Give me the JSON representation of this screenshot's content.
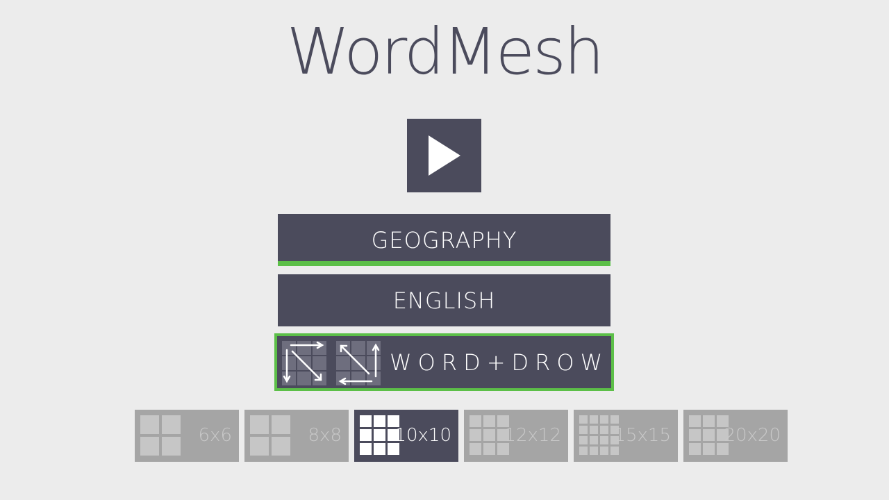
{
  "app": {
    "title": "WordMesh"
  },
  "play": {
    "icon": "play-icon"
  },
  "categories": [
    {
      "label": "GEOGRAPHY",
      "selected": true
    },
    {
      "label": "ENGLISH",
      "selected": false
    }
  ],
  "mode": {
    "label": "WORD+DROW",
    "selected": true,
    "icons": [
      "forward-directions-grid-icon",
      "reverse-directions-grid-icon"
    ]
  },
  "sizes": [
    {
      "label": "6x6",
      "selected": false,
      "icon": "grid-2x2-icon"
    },
    {
      "label": "8x8",
      "selected": false,
      "icon": "grid-2x2-icon"
    },
    {
      "label": "10x10",
      "selected": true,
      "icon": "grid-3x3-icon"
    },
    {
      "label": "12x12",
      "selected": false,
      "icon": "grid-3x3-icon"
    },
    {
      "label": "15x15",
      "selected": false,
      "icon": "grid-4x4-icon"
    },
    {
      "label": "20x20",
      "selected": false,
      "icon": "grid-3x3-icon"
    }
  ],
  "colors": {
    "primary": "#4b4b5c",
    "accent": "#5cbf48",
    "background": "#ececec",
    "disabled": "#a5a5a5"
  }
}
